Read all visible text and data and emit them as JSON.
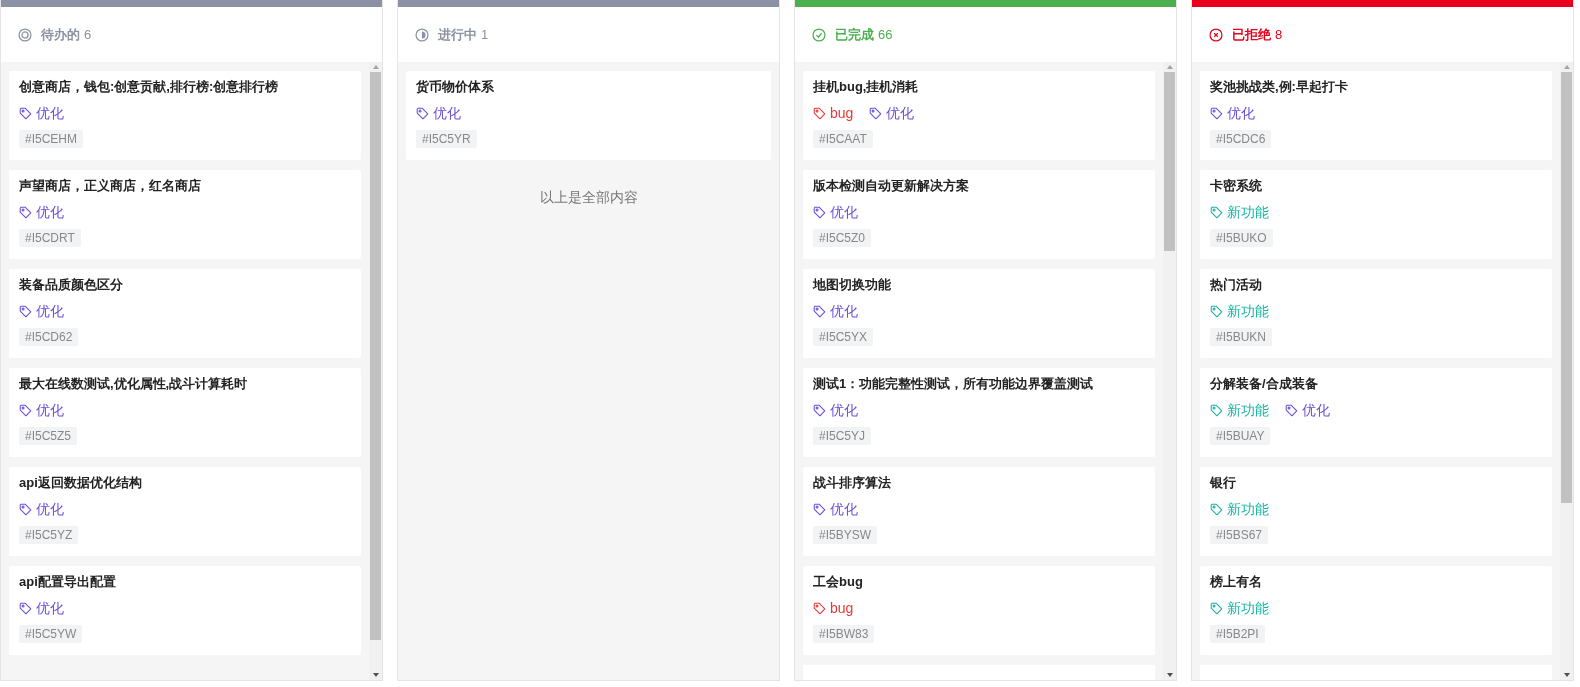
{
  "columns": [
    {
      "kind": "todo",
      "title": "待办的",
      "count": "6",
      "scrollable": true,
      "more_below": false,
      "cards": [
        {
          "title": "创意商店，钱包:创意贡献,排行榜:创意排行榜",
          "tags": [
            {
              "kind": "optimize",
              "label": "优化"
            }
          ],
          "id": "#I5CEHM"
        },
        {
          "title": "声望商店，正义商店，红名商店",
          "tags": [
            {
              "kind": "optimize",
              "label": "优化"
            }
          ],
          "id": "#I5CDRT"
        },
        {
          "title": "装备品质颜色区分",
          "tags": [
            {
              "kind": "optimize",
              "label": "优化"
            }
          ],
          "id": "#I5CD62"
        },
        {
          "title": "最大在线数测试,优化属性,战斗计算耗时",
          "tags": [
            {
              "kind": "optimize",
              "label": "优化"
            }
          ],
          "id": "#I5C5Z5"
        },
        {
          "title": "api返回数据优化结构",
          "tags": [
            {
              "kind": "optimize",
              "label": "优化"
            }
          ],
          "id": "#I5C5YZ"
        },
        {
          "title": "api配置导出配置",
          "tags": [
            {
              "kind": "optimize",
              "label": "优化"
            }
          ],
          "id": "#I5C5YW"
        }
      ]
    },
    {
      "kind": "progress",
      "title": "进行中",
      "count": "1",
      "scrollable": false,
      "more_below": false,
      "end_note": "以上是全部内容",
      "cards": [
        {
          "title": "货币物价体系",
          "tags": [
            {
              "kind": "optimize",
              "label": "优化"
            }
          ],
          "id": "#I5C5YR"
        }
      ]
    },
    {
      "kind": "done",
      "title": "已完成",
      "count": "66",
      "scrollable": true,
      "more_below": true,
      "cards": [
        {
          "title": "挂机bug,挂机消耗",
          "tags": [
            {
              "kind": "bug",
              "label": "bug"
            },
            {
              "kind": "optimize",
              "label": "优化"
            }
          ],
          "id": "#I5CAAT"
        },
        {
          "title": "版本检测自动更新解决方案",
          "tags": [
            {
              "kind": "optimize",
              "label": "优化"
            }
          ],
          "id": "#I5C5Z0"
        },
        {
          "title": "地图切换功能",
          "tags": [
            {
              "kind": "optimize",
              "label": "优化"
            }
          ],
          "id": "#I5C5YX"
        },
        {
          "title": "测试1：功能完整性测试，所有功能边界覆盖测试",
          "tags": [
            {
              "kind": "optimize",
              "label": "优化"
            }
          ],
          "id": "#I5C5YJ"
        },
        {
          "title": "战斗排序算法",
          "tags": [
            {
              "kind": "optimize",
              "label": "优化"
            }
          ],
          "id": "#I5BYSW"
        },
        {
          "title": "工会bug",
          "tags": [
            {
              "kind": "bug",
              "label": "bug"
            }
          ],
          "id": "#I5BW83"
        }
      ]
    },
    {
      "kind": "rejected",
      "title": "已拒绝",
      "count": "8",
      "scrollable": true,
      "more_below": true,
      "cards": [
        {
          "title": "奖池挑战类,例:早起打卡",
          "tags": [
            {
              "kind": "optimize",
              "label": "优化"
            }
          ],
          "id": "#I5CDC6"
        },
        {
          "title": "卡密系统",
          "tags": [
            {
              "kind": "feature",
              "label": "新功能"
            }
          ],
          "id": "#I5BUKO"
        },
        {
          "title": "热门活动",
          "tags": [
            {
              "kind": "feature",
              "label": "新功能"
            }
          ],
          "id": "#I5BUKN"
        },
        {
          "title": "分解装备/合成装备",
          "tags": [
            {
              "kind": "feature",
              "label": "新功能"
            },
            {
              "kind": "optimize",
              "label": "优化"
            }
          ],
          "id": "#I5BUAY"
        },
        {
          "title": "银行",
          "tags": [
            {
              "kind": "feature",
              "label": "新功能"
            }
          ],
          "id": "#I5BS67"
        },
        {
          "title": "榜上有名",
          "tags": [
            {
              "kind": "feature",
              "label": "新功能"
            }
          ],
          "id": "#I5B2PI"
        }
      ]
    }
  ]
}
